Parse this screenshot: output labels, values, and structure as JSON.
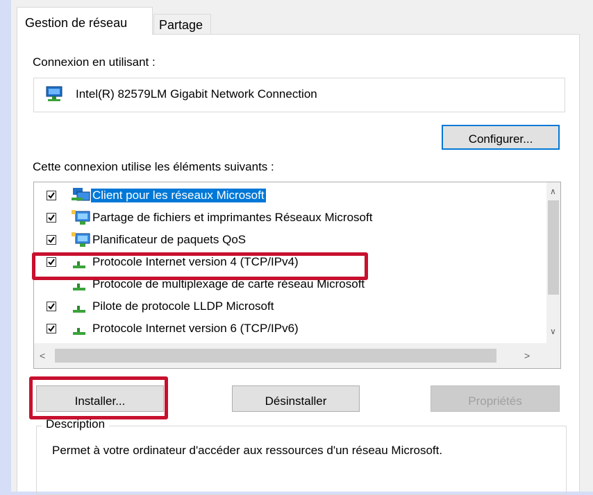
{
  "tabs": [
    {
      "label": "Gestion de réseau",
      "active": true
    },
    {
      "label": "Partage",
      "active": false
    }
  ],
  "connect_label": "Connexion en utilisant :",
  "adapter": {
    "name": "Intel(R) 82579LM Gigabit Network Connection",
    "icon": "network-adapter-icon"
  },
  "configure_button": "Configurer...",
  "items_label": "Cette connexion utilise les éléments suivants :",
  "items": [
    {
      "label": "Client pour les réseaux Microsoft",
      "checked": true,
      "selected": true,
      "icon": "network-client-icon"
    },
    {
      "label": "Partage de fichiers et imprimantes Réseaux Microsoft",
      "checked": true,
      "selected": false,
      "icon": "network-service-icon"
    },
    {
      "label": "Planificateur de paquets QoS",
      "checked": true,
      "selected": false,
      "icon": "network-service-icon"
    },
    {
      "label": "Protocole Internet version 4 (TCP/IPv4)",
      "checked": true,
      "selected": false,
      "icon": "protocol-icon"
    },
    {
      "label": "Protocole de multiplexage de carte réseau Microsoft",
      "checked": false,
      "selected": false,
      "icon": "protocol-icon"
    },
    {
      "label": "Pilote de protocole LLDP Microsoft",
      "checked": true,
      "selected": false,
      "icon": "protocol-icon"
    },
    {
      "label": "Protocole Internet version 6 (TCP/IPv6)",
      "checked": true,
      "selected": false,
      "icon": "protocol-icon"
    }
  ],
  "buttons": {
    "install": "Installer...",
    "uninstall": "Désinstaller",
    "properties": "Propriétés",
    "properties_disabled": true
  },
  "description": {
    "title": "Description",
    "text": "Permet à votre ordinateur d'accéder aux ressources d'un réseau Microsoft."
  },
  "colors": {
    "selection": "#0078d7",
    "highlight": "#c8102e",
    "background": "#d6def7"
  }
}
